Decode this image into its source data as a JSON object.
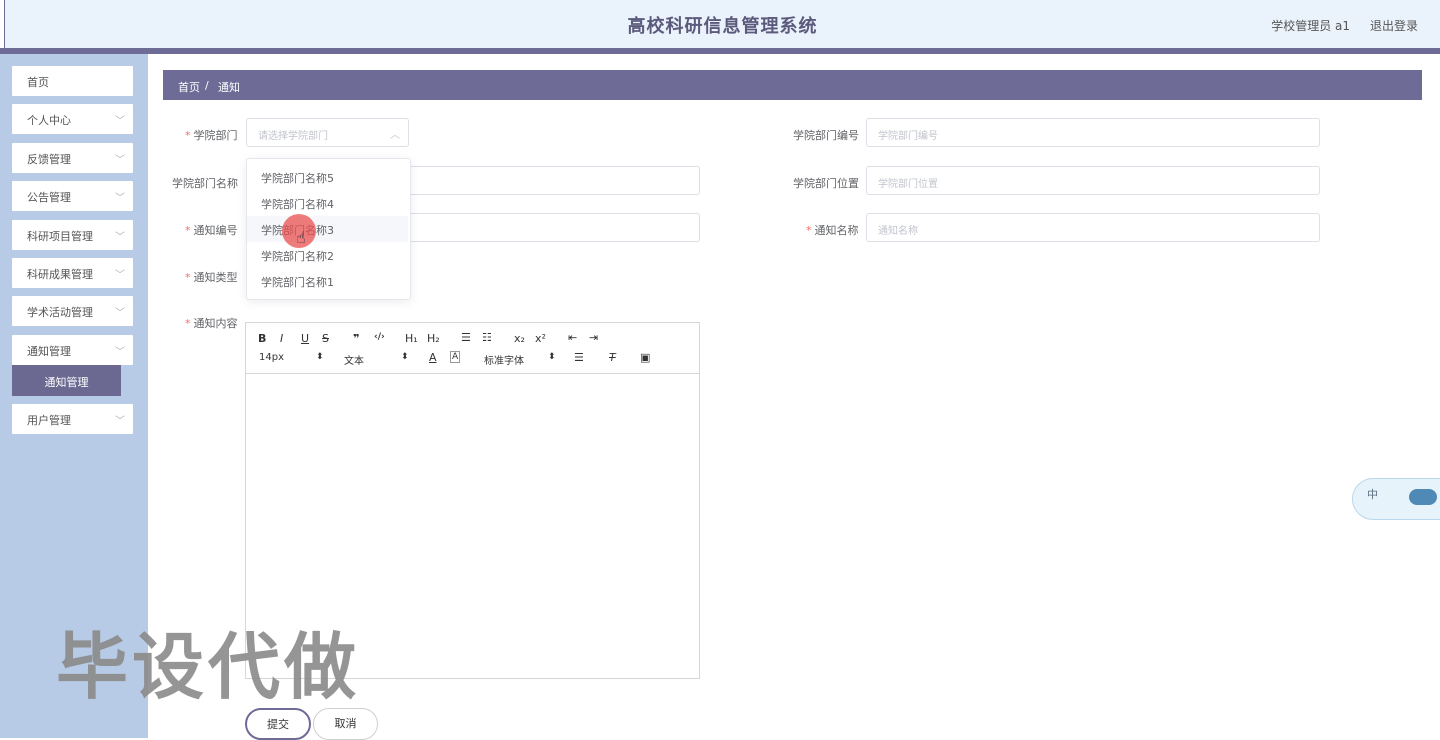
{
  "header": {
    "title": "高校科研信息管理系统",
    "user": "学校管理员 a1",
    "logout": "退出登录"
  },
  "sidebar": {
    "items": [
      {
        "label": "首页",
        "chevron": false
      },
      {
        "label": "个人中心",
        "chevron": true
      },
      {
        "label": "反馈管理",
        "chevron": true
      },
      {
        "label": "公告管理",
        "chevron": true
      },
      {
        "label": "科研项目管理",
        "chevron": true
      },
      {
        "label": "科研成果管理",
        "chevron": true
      },
      {
        "label": "学术活动管理",
        "chevron": true
      },
      {
        "label": "通知管理",
        "chevron": true
      },
      {
        "label": "用户管理",
        "chevron": true
      }
    ],
    "sub_active": "通知管理"
  },
  "breadcrumb": {
    "home": "首页",
    "sep": "/",
    "current": "通知"
  },
  "form": {
    "dept": {
      "label": "学院部门",
      "placeholder": "请选择学院部门",
      "arrow": "︿"
    },
    "dept_no": {
      "label": "学院部门编号",
      "placeholder": "学院部门编号"
    },
    "dept_name": {
      "label": "学院部门名称"
    },
    "dept_location": {
      "label": "学院部门位置",
      "placeholder": "学院部门位置"
    },
    "notice_no": {
      "label": "通知编号"
    },
    "notice_name": {
      "label": "通知名称",
      "placeholder": "通知名称"
    },
    "notice_type": {
      "label": "通知类型"
    },
    "notice_content": {
      "label": "通知内容"
    },
    "required_mark": "*"
  },
  "dropdown": {
    "options": [
      "学院部门名称5",
      "学院部门名称4",
      "学院部门名称3",
      "学院部门名称2",
      "学院部门名称1"
    ],
    "hovered": "学院部门名称3"
  },
  "editor": {
    "row1": [
      "B",
      "I",
      "U",
      "S",
      "❞",
      "‹/›",
      "H₁",
      "H₂",
      "☰",
      "☷",
      "x₂",
      "x²",
      "⇤",
      "⇥"
    ],
    "font_size": "14px",
    "header_select": "文本",
    "font_family": "标准字体",
    "select_arrow": "⬍",
    "color_icon": "A",
    "bg_icon": "A",
    "align_icon": "☰",
    "clean_icon": "T",
    "image_icon": "▣"
  },
  "buttons": {
    "submit": "提交",
    "cancel": "取消"
  },
  "watermark": "毕设代做",
  "ime": {
    "label": "中"
  },
  "colors": {
    "primary": "#6e6b96",
    "sidebar_bg": "#b7cbe6",
    "header_bg": "#eaf3fb",
    "required": "#f56c6c"
  },
  "icons": {
    "chevron": "chevron-down-icon",
    "cursor": "hand-pointer-icon"
  }
}
